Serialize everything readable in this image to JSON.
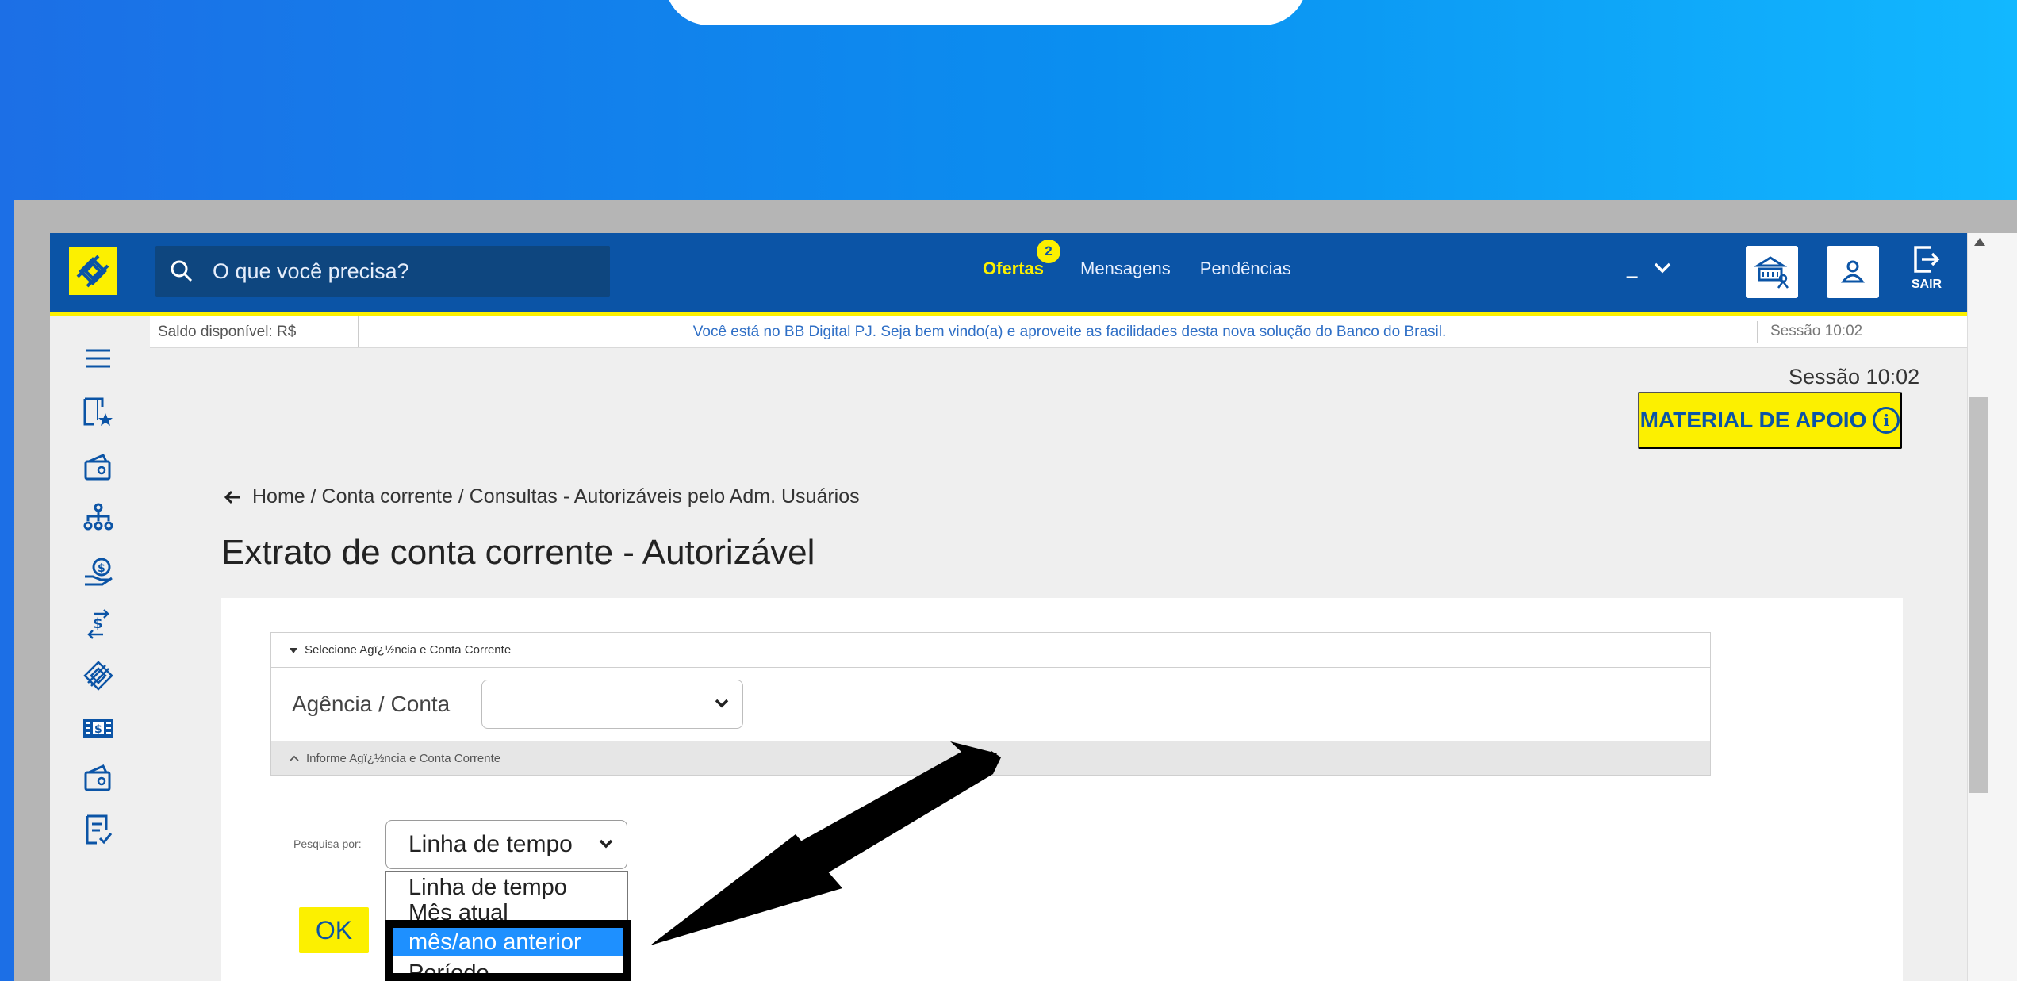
{
  "search": {
    "placeholder": "O que você precisa?"
  },
  "topnav": {
    "offers": "Ofertas",
    "offers_badge": "2",
    "messages": "Mensagens",
    "pending": "Pendências"
  },
  "account_dropdown": {
    "value": "_"
  },
  "header": {
    "exit_label": "SAIR"
  },
  "infobar": {
    "balance": "Saldo disponível: R$",
    "welcome": "Você está no BB Digital PJ. Seja bem vindo(a) e aproveite as facilidades desta nova solução do Banco do Brasil.",
    "session": "Sessão 10:02"
  },
  "content": {
    "session": "Sessão 10:02",
    "material_button": "MATERIAL DE APOIO",
    "material_icon": "i",
    "breadcrumb": "Home / Conta corrente / Consultas - Autorizáveis pelo Adm. Usuários",
    "page_title": "Extrato de conta corrente - Autorizável"
  },
  "account_section": {
    "header": "Selecione Agï¿½ncia e Conta Corrente",
    "field_label": "Agência / Conta",
    "field_value": "",
    "footer": "Informe Agï¿½ncia e Conta Corrente"
  },
  "search_form": {
    "label": "Pesquisa por:",
    "selected": "Linha de tempo",
    "ok_label": "OK",
    "options": [
      "Linha de tempo",
      "Mês atual",
      "mês/ano anterior",
      "Período"
    ],
    "highlighted_option": "mês/ano anterior"
  },
  "sidebar": {
    "items": [
      "menu-icon",
      "favorites-icon",
      "wallet-icon",
      "organization-icon",
      "hand-money-icon",
      "transfer-icon",
      "bb-logo-icon",
      "cash-icon",
      "wallet-icon",
      "document-icon"
    ]
  },
  "colors": {
    "brand_blue": "#0b54a6",
    "brand_yellow": "#fcf000",
    "selection_blue": "#1e90ff"
  }
}
